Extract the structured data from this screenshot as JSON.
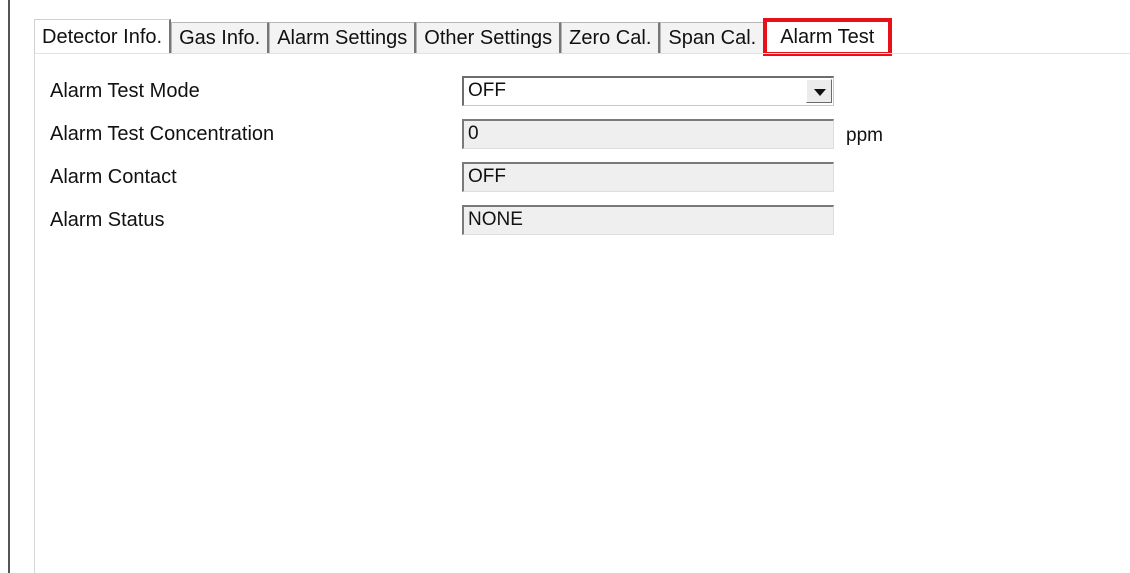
{
  "tabs": [
    {
      "label": "Detector Info."
    },
    {
      "label": "Gas Info."
    },
    {
      "label": "Alarm Settings"
    },
    {
      "label": "Other Settings"
    },
    {
      "label": "Zero Cal."
    },
    {
      "label": "Span Cal."
    },
    {
      "label": "Alarm Test"
    }
  ],
  "selected_tab": "Alarm Test",
  "highlight_color": "#e8111a",
  "fields": {
    "alarm_test_mode": {
      "label": "Alarm Test Mode",
      "value": "OFF"
    },
    "alarm_test_concentration": {
      "label": "Alarm Test Concentration",
      "value": "0",
      "unit": "ppm"
    },
    "alarm_contact": {
      "label": "Alarm Contact",
      "value": "OFF"
    },
    "alarm_status": {
      "label": "Alarm Status",
      "value": "NONE"
    }
  },
  "icons": {
    "dropdown": "chevron-down-icon"
  }
}
